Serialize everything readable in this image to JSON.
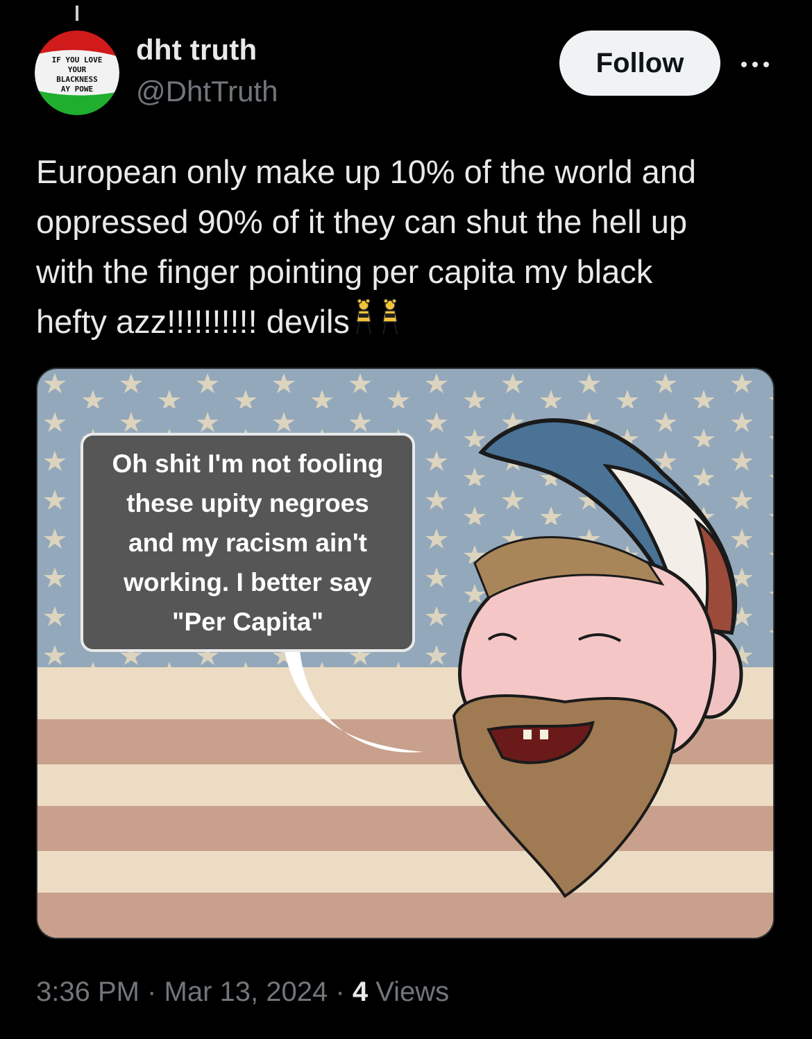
{
  "author": {
    "display_name": "dht truth",
    "handle": "@DhtTruth",
    "avatar_text": [
      "IF YOU LOVE",
      "YOUR",
      "BLACKNESS",
      "AY POWE"
    ]
  },
  "follow_label": "Follow",
  "tweet": {
    "text": "European only make up 10% of the world and\noppressed 90% of it they can shut the hell up\nwith the finger pointing per capita my black\nhefty azz!!!!!!!!!! devils",
    "emoji": "dancing-women-emoji"
  },
  "image": {
    "speech_bubble": "Oh shit I'm not fooling\nthese upity negroes\nand my racism ain't\nworking. I better say\n\"Per Capita\""
  },
  "meta": {
    "time": "3:36 PM",
    "date": "Mar 13, 2024",
    "separator": "·",
    "views_count": "4",
    "views_label": "Views"
  },
  "colors": {
    "background": "#000000",
    "text_primary": "#e7e9ea",
    "text_secondary": "#71767b",
    "follow_bg": "#eff3f4",
    "flag_blue": "#8fa4b6",
    "flag_stripe_red": "#c99a86",
    "flag_stripe_light": "#ecdcc4"
  }
}
